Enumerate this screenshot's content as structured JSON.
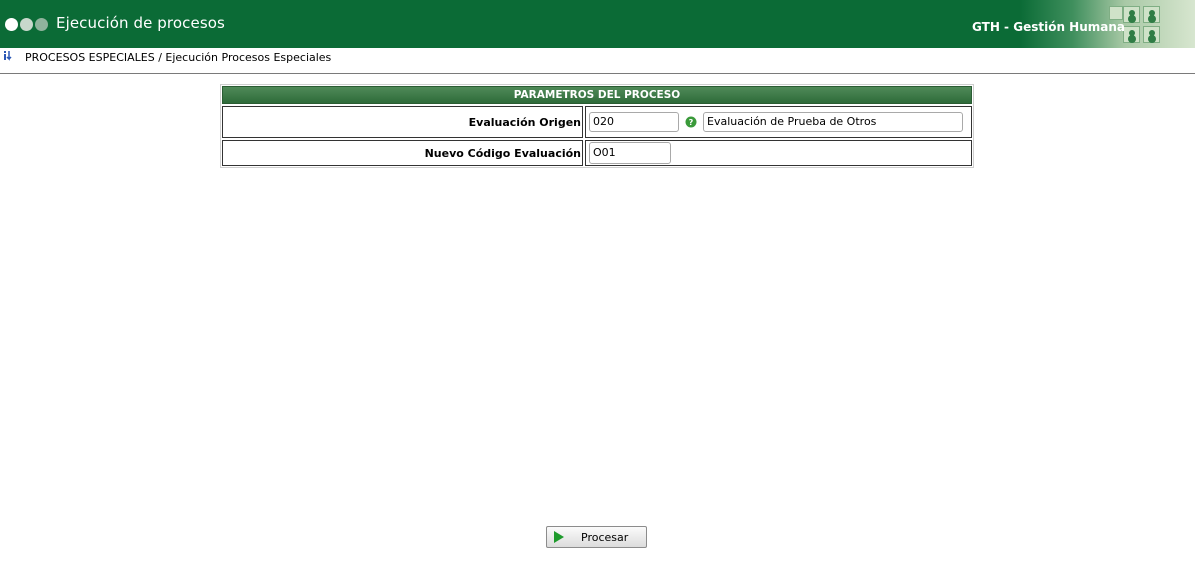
{
  "header": {
    "title": "Ejecución de procesos",
    "brand": "GTH - Gestión Humana",
    "icons": [
      "window-dots-icon",
      "people-grid-icon"
    ]
  },
  "breadcrumb": {
    "text": "PROCESOS ESPECIALES / Ejecución Procesos Especiales",
    "icon": "info-arrow-icon"
  },
  "params": {
    "title": "PARAMETROS DEL PROCESO",
    "rows": [
      {
        "label": "Evaluación Origen",
        "code_value": "020",
        "help_icon": "help-icon",
        "description_value": "Evaluación de Prueba de Otros"
      },
      {
        "label": "Nuevo Código Evaluación",
        "code_value": "O01"
      }
    ]
  },
  "actions": {
    "process_label": "Procesar",
    "process_icon": "play-icon"
  },
  "colors": {
    "header_bg": "#0b6b36",
    "table_header_bg": "#3d7b48",
    "help_icon": "#3a9a3a",
    "play_icon": "#1e9a2c"
  }
}
